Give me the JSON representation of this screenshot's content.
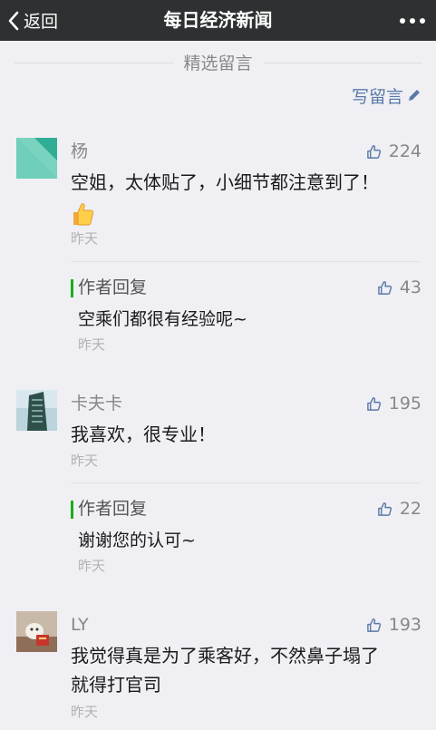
{
  "topbar": {
    "back_label": "返回",
    "title": "每日经济新闻"
  },
  "section": {
    "label": "精选留言"
  },
  "write_button": {
    "label": "写留言"
  },
  "comments": [
    {
      "name": "杨",
      "likes": "224",
      "text": "空姐，太体贴了，小细节都注意到了！",
      "time": "昨天",
      "reply": {
        "label": "作者回复",
        "likes": "43",
        "text": "空乘们都很有经验呢~",
        "time": "昨天"
      }
    },
    {
      "name": "卡夫卡",
      "likes": "195",
      "text": "我喜欢，很专业！",
      "time": "昨天",
      "reply": {
        "label": "作者回复",
        "likes": "22",
        "text": "谢谢您的认可~",
        "time": "昨天"
      }
    },
    {
      "name": "LY",
      "likes": "193",
      "text_line1": "我觉得真是为了乘客好，不然鼻子塌了",
      "text_line2": "就得打官司",
      "time": "昨天"
    }
  ],
  "colors": {
    "topbar_bg": "#2e3132",
    "page_bg": "#efeff4",
    "link_blue": "#5a7aa8",
    "reply_accent": "#1aad19"
  }
}
